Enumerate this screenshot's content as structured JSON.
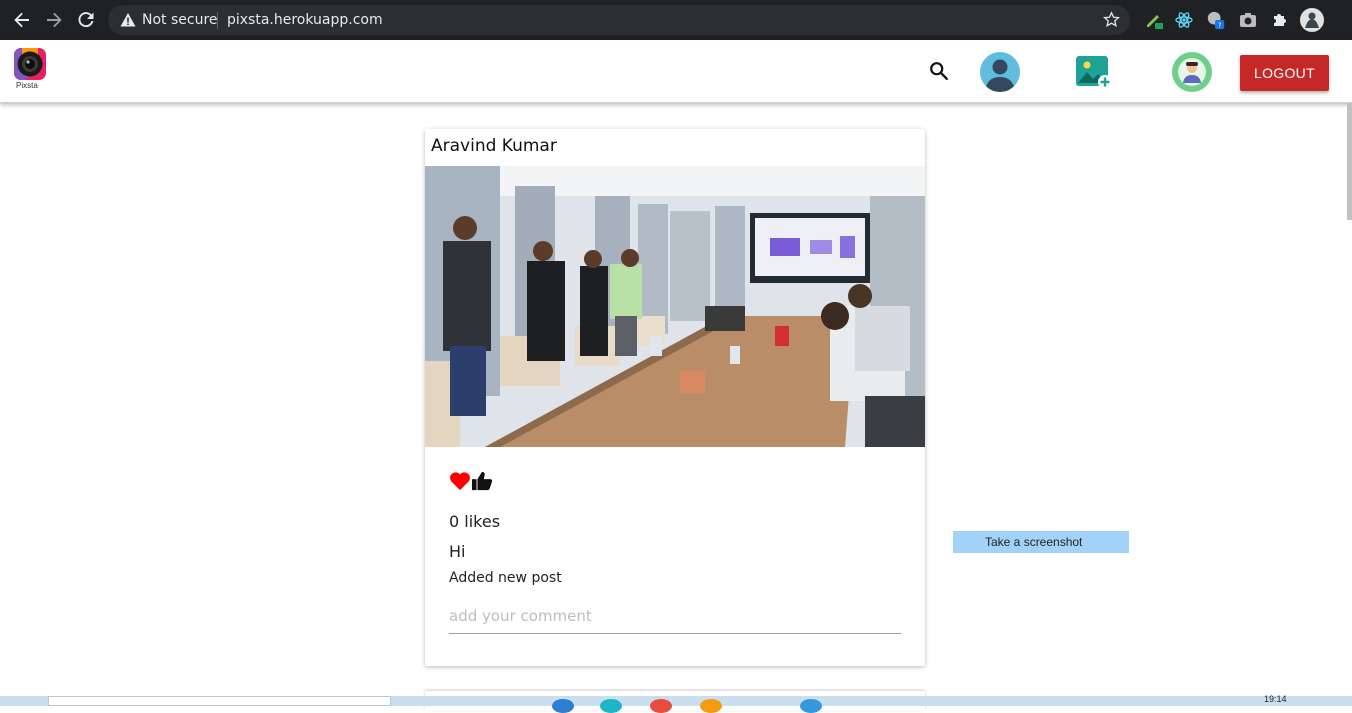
{
  "browser": {
    "security_label": "Not secure",
    "url": "pixsta.herokuapp.com"
  },
  "app": {
    "logo_text": "Pixsta",
    "logout_label": "LOGOUT"
  },
  "post": {
    "author": "Aravind Kumar",
    "likes_text": "0 likes",
    "title": "Hi",
    "body": "Added new post",
    "comment_placeholder": "add your comment",
    "comment_value": ""
  },
  "overlay": {
    "screenshot_label": "Take a screenshot"
  },
  "taskbar": {
    "time": "19:14"
  },
  "colors": {
    "logout_bg": "#c62828",
    "heart": "#ff0000",
    "screenshot_bg": "#a2d2f7"
  },
  "icons": [
    "back-icon",
    "forward-icon",
    "reload-icon",
    "warning-icon",
    "star-icon",
    "search-icon",
    "add-photo-icon",
    "heart-icon",
    "thumbs-up-icon"
  ]
}
